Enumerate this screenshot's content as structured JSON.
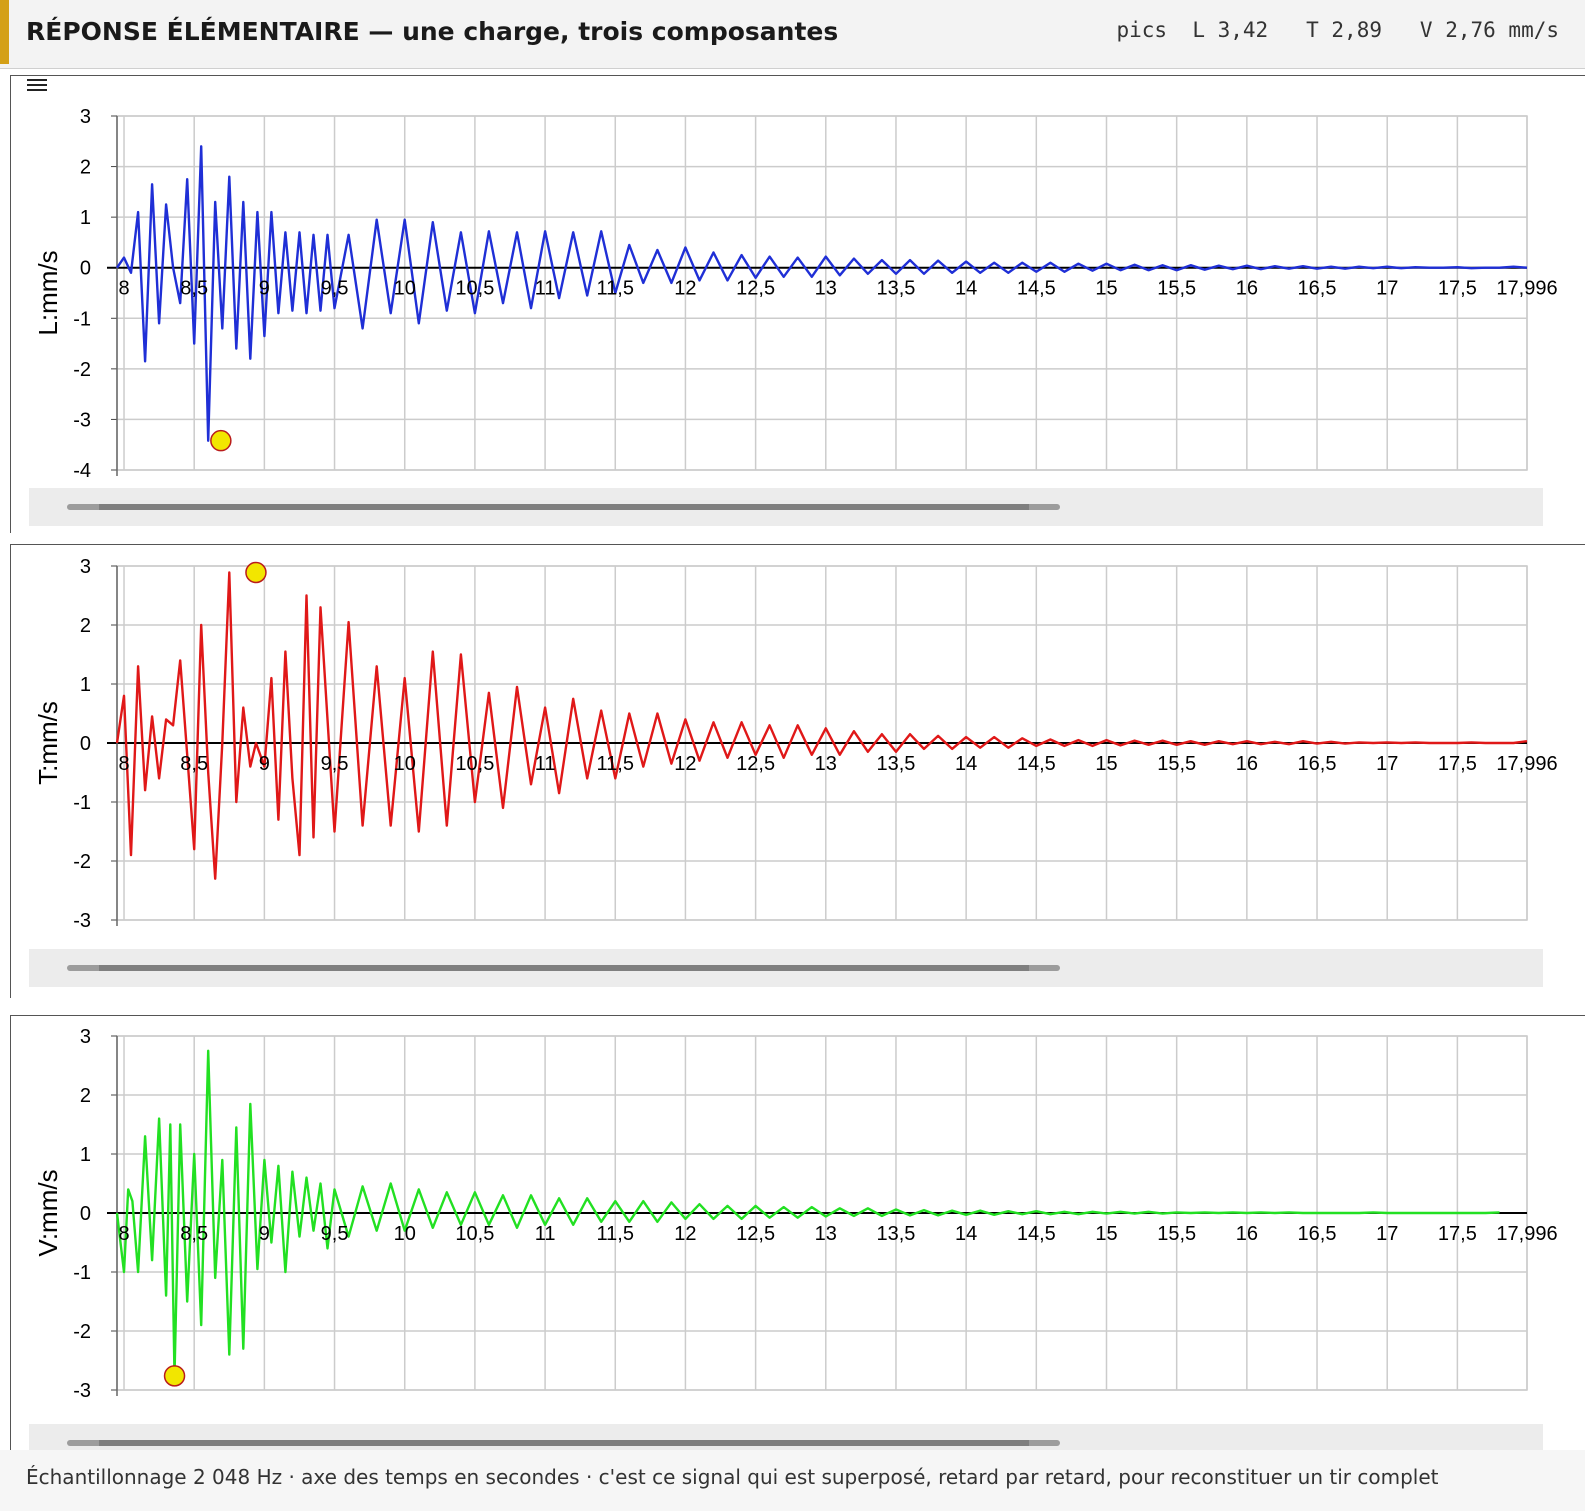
{
  "header": {
    "title": "RÉPONSE ÉLÉMENTAIRE — une charge, trois composantes",
    "peaks_text": "pics  L 3,42   T 2,89   V 2,76 mm/s"
  },
  "footer": {
    "caption": "Échantillonnage 2 048 Hz · axe des temps en secondes · c'est ce signal qui est superposé, retard par retard, pour reconstituer un tir complet"
  },
  "colors": {
    "accent": "#d4a017",
    "L": "#1f2fd6",
    "T": "#e01818",
    "V": "#22e022",
    "peak_marker": "#f2e600",
    "grid": "#cccccc"
  },
  "chart_data": [
    {
      "type": "line",
      "series": [
        {
          "values": "see x/y"
        }
      ],
      "ylabel": "L:mm/s",
      "xlim": [
        7.95,
        17.996
      ],
      "ylim": [
        -4,
        3
      ],
      "x_ticks": [
        "8",
        "8,5",
        "9",
        "9,5",
        "10",
        "10,5",
        "11",
        "11,5",
        "12",
        "12,5",
        "13",
        "13,5",
        "14",
        "14,5",
        "15",
        "15,5",
        "16",
        "16,5",
        "17",
        "17,5",
        "17,996"
      ],
      "x_tick_values": [
        8,
        8.5,
        9,
        9.5,
        10,
        10.5,
        11,
        11.5,
        12,
        12.5,
        13,
        13.5,
        14,
        14.5,
        15,
        15.5,
        16,
        16.5,
        17,
        17.5,
        17.996
      ],
      "y_ticks": [
        3,
        2,
        1,
        0,
        -1,
        -2,
        -3,
        -4
      ],
      "y_tick_labels": [
        "3",
        "2",
        "1",
        "0",
        "-1",
        "-2",
        "-3",
        "-4"
      ],
      "grid": true,
      "peak": {
        "x": 8.69,
        "y": -3.42
      },
      "x": [
        7.95,
        8.0,
        8.05,
        8.1,
        8.15,
        8.2,
        8.25,
        8.3,
        8.35,
        8.4,
        8.45,
        8.5,
        8.55,
        8.6,
        8.65,
        8.7,
        8.75,
        8.8,
        8.85,
        8.9,
        8.95,
        9.0,
        9.05,
        9.1,
        9.15,
        9.2,
        9.25,
        9.3,
        9.35,
        9.4,
        9.45,
        9.5,
        9.6,
        9.7,
        9.8,
        9.9,
        10.0,
        10.1,
        10.2,
        10.3,
        10.4,
        10.5,
        10.6,
        10.7,
        10.8,
        10.9,
        11.0,
        11.1,
        11.2,
        11.3,
        11.4,
        11.5,
        11.6,
        11.7,
        11.8,
        11.9,
        12.0,
        12.1,
        12.2,
        12.3,
        12.4,
        12.5,
        12.6,
        12.7,
        12.8,
        12.9,
        13.0,
        13.1,
        13.2,
        13.3,
        13.4,
        13.5,
        13.6,
        13.7,
        13.8,
        13.9,
        14.0,
        14.1,
        14.2,
        14.3,
        14.4,
        14.5,
        14.6,
        14.7,
        14.8,
        14.9,
        15.0,
        15.1,
        15.2,
        15.3,
        15.4,
        15.5,
        15.6,
        15.7,
        15.8,
        15.9,
        16.0,
        16.1,
        16.2,
        16.3,
        16.4,
        16.5,
        16.6,
        16.7,
        16.8,
        16.9,
        17.0,
        17.1,
        17.2,
        17.3,
        17.4,
        17.5,
        17.6,
        17.7,
        17.8,
        17.9,
        17.996
      ],
      "y": [
        0.0,
        0.2,
        -0.1,
        1.1,
        -1.85,
        1.65,
        -1.1,
        1.25,
        0.0,
        -0.7,
        1.75,
        -1.5,
        2.4,
        -3.42,
        1.3,
        -1.2,
        1.8,
        -1.6,
        1.3,
        -1.8,
        1.1,
        -1.35,
        1.1,
        -0.9,
        0.7,
        -0.85,
        0.7,
        -0.9,
        0.65,
        -0.85,
        0.65,
        -0.8,
        0.65,
        -1.2,
        0.95,
        -0.9,
        0.95,
        -1.1,
        0.9,
        -0.85,
        0.7,
        -0.9,
        0.72,
        -0.7,
        0.7,
        -0.8,
        0.72,
        -0.6,
        0.7,
        -0.55,
        0.72,
        -0.5,
        0.45,
        -0.3,
        0.35,
        -0.3,
        0.4,
        -0.25,
        0.3,
        -0.25,
        0.25,
        -0.2,
        0.22,
        -0.18,
        0.2,
        -0.18,
        0.22,
        -0.15,
        0.18,
        -0.12,
        0.15,
        -0.12,
        0.15,
        -0.12,
        0.14,
        -0.1,
        0.12,
        -0.1,
        0.1,
        -0.1,
        0.1,
        -0.08,
        0.1,
        -0.08,
        0.08,
        -0.06,
        0.08,
        -0.05,
        0.06,
        -0.05,
        0.05,
        -0.05,
        0.05,
        -0.04,
        0.04,
        -0.03,
        0.04,
        -0.03,
        0.03,
        -0.02,
        0.03,
        -0.02,
        0.02,
        -0.02,
        0.02,
        -0.01,
        0.02,
        -0.01,
        0.01,
        0.0,
        0.0,
        0.01,
        -0.01,
        0.0,
        0.0,
        0.02,
        0.0
      ]
    },
    {
      "type": "line",
      "series": [
        {
          "values": "see x/y"
        }
      ],
      "ylabel": "T:mm/s",
      "xlim": [
        7.95,
        17.996
      ],
      "ylim": [
        -3,
        3
      ],
      "x_ticks": [
        "8",
        "8,5",
        "9",
        "9,5",
        "10",
        "10,5",
        "11",
        "11,5",
        "12",
        "12,5",
        "13",
        "13,5",
        "14",
        "14,5",
        "15",
        "15,5",
        "16",
        "16,5",
        "17",
        "17,5",
        "17,996"
      ],
      "x_tick_values": [
        8,
        8.5,
        9,
        9.5,
        10,
        10.5,
        11,
        11.5,
        12,
        12.5,
        13,
        13.5,
        14,
        14.5,
        15,
        15.5,
        16,
        16.5,
        17,
        17.5,
        17.996
      ],
      "y_ticks": [
        3,
        2,
        1,
        0,
        -1,
        -2,
        -3
      ],
      "y_tick_labels": [
        "3",
        "2",
        "1",
        "0",
        "-1",
        "-2",
        "-3"
      ],
      "grid": true,
      "peak": {
        "x": 8.94,
        "y": 2.89
      },
      "x": [
        7.95,
        8.0,
        8.05,
        8.1,
        8.15,
        8.2,
        8.25,
        8.3,
        8.35,
        8.4,
        8.45,
        8.5,
        8.55,
        8.6,
        8.65,
        8.7,
        8.75,
        8.8,
        8.85,
        8.9,
        8.94,
        9.0,
        9.05,
        9.1,
        9.15,
        9.2,
        9.25,
        9.3,
        9.35,
        9.4,
        9.5,
        9.6,
        9.7,
        9.8,
        9.9,
        10.0,
        10.1,
        10.2,
        10.3,
        10.4,
        10.5,
        10.6,
        10.7,
        10.8,
        10.9,
        11.0,
        11.1,
        11.2,
        11.3,
        11.4,
        11.5,
        11.6,
        11.7,
        11.8,
        11.9,
        12.0,
        12.1,
        12.2,
        12.3,
        12.4,
        12.5,
        12.6,
        12.7,
        12.8,
        12.9,
        13.0,
        13.1,
        13.2,
        13.3,
        13.4,
        13.5,
        13.6,
        13.7,
        13.8,
        13.9,
        14.0,
        14.1,
        14.2,
        14.3,
        14.4,
        14.5,
        14.6,
        14.7,
        14.8,
        14.9,
        15.0,
        15.1,
        15.2,
        15.3,
        15.4,
        15.5,
        15.6,
        15.7,
        15.8,
        15.9,
        16.0,
        16.1,
        16.2,
        16.3,
        16.4,
        16.5,
        16.6,
        16.7,
        16.8,
        16.9,
        17.0,
        17.1,
        17.2,
        17.3,
        17.4,
        17.5,
        17.6,
        17.7,
        17.8,
        17.9,
        17.996
      ],
      "y": [
        0.0,
        0.8,
        -1.9,
        1.3,
        -0.8,
        0.45,
        -0.6,
        0.4,
        0.3,
        1.4,
        -0.2,
        -1.8,
        2.0,
        -0.5,
        -2.3,
        0.0,
        2.89,
        -1.0,
        0.6,
        -0.4,
        0.0,
        -0.4,
        1.1,
        -1.3,
        1.55,
        -0.6,
        -1.9,
        2.5,
        -1.6,
        2.3,
        -1.5,
        2.05,
        -1.4,
        1.3,
        -1.4,
        1.1,
        -1.5,
        1.55,
        -1.4,
        1.5,
        -1.0,
        0.85,
        -1.1,
        0.95,
        -0.7,
        0.6,
        -0.85,
        0.75,
        -0.6,
        0.55,
        -0.6,
        0.5,
        -0.4,
        0.5,
        -0.35,
        0.4,
        -0.3,
        0.35,
        -0.25,
        0.35,
        -0.2,
        0.3,
        -0.25,
        0.3,
        -0.2,
        0.25,
        -0.2,
        0.2,
        -0.15,
        0.15,
        -0.15,
        0.15,
        -0.1,
        0.12,
        -0.1,
        0.1,
        -0.08,
        0.1,
        -0.08,
        0.08,
        -0.05,
        0.06,
        -0.05,
        0.05,
        -0.05,
        0.05,
        -0.04,
        0.04,
        -0.03,
        0.04,
        -0.03,
        0.03,
        -0.03,
        0.03,
        -0.02,
        0.03,
        -0.02,
        0.02,
        -0.02,
        0.03,
        -0.01,
        0.02,
        -0.01,
        0.01,
        0.0,
        0.01,
        0.0,
        0.01,
        0.0,
        0.0,
        0.0,
        0.01,
        0.0,
        0.0,
        0.0,
        0.03
      ]
    },
    {
      "type": "line",
      "series": [
        {
          "values": "see x/y"
        }
      ],
      "ylabel": "V:mm/s",
      "xlim": [
        7.95,
        17.996
      ],
      "ylim": [
        -3,
        3
      ],
      "x_ticks": [
        "8",
        "8,5",
        "9",
        "9,5",
        "10",
        "10,5",
        "11",
        "11,5",
        "12",
        "12,5",
        "13",
        "13,5",
        "14",
        "14,5",
        "15",
        "15,5",
        "16",
        "16,5",
        "17",
        "17,5",
        "17,996"
      ],
      "x_tick_values": [
        8,
        8.5,
        9,
        9.5,
        10,
        10.5,
        11,
        11.5,
        12,
        12.5,
        13,
        13.5,
        14,
        14.5,
        15,
        15.5,
        16,
        16.5,
        17,
        17.5,
        17.996
      ],
      "y_ticks": [
        3,
        2,
        1,
        0,
        -1,
        -2,
        -3
      ],
      "y_tick_labels": [
        "3",
        "2",
        "1",
        "0",
        "-1",
        "-2",
        "-3"
      ],
      "grid": true,
      "peak": {
        "x": 8.36,
        "y": -2.76
      },
      "x": [
        7.95,
        8.0,
        8.03,
        8.06,
        8.1,
        8.15,
        8.2,
        8.25,
        8.3,
        8.33,
        8.36,
        8.4,
        8.45,
        8.5,
        8.55,
        8.6,
        8.65,
        8.7,
        8.75,
        8.8,
        8.85,
        8.9,
        8.95,
        9.0,
        9.05,
        9.1,
        9.15,
        9.2,
        9.25,
        9.3,
        9.35,
        9.4,
        9.45,
        9.5,
        9.6,
        9.7,
        9.8,
        9.9,
        10.0,
        10.1,
        10.2,
        10.3,
        10.4,
        10.5,
        10.6,
        10.7,
        10.8,
        10.9,
        11.0,
        11.1,
        11.2,
        11.3,
        11.4,
        11.5,
        11.6,
        11.7,
        11.8,
        11.9,
        12.0,
        12.1,
        12.2,
        12.3,
        12.4,
        12.5,
        12.6,
        12.7,
        12.8,
        12.9,
        13.0,
        13.1,
        13.2,
        13.3,
        13.4,
        13.5,
        13.6,
        13.7,
        13.8,
        13.9,
        14.0,
        14.1,
        14.2,
        14.3,
        14.4,
        14.5,
        14.6,
        14.7,
        14.8,
        14.9,
        15.0,
        15.1,
        15.2,
        15.3,
        15.4,
        15.5,
        15.6,
        15.7,
        15.8,
        15.9,
        16.0,
        16.1,
        16.2,
        16.3,
        16.4,
        16.5,
        16.6,
        16.7,
        16.8,
        16.9,
        17.0,
        17.1,
        17.2,
        17.3,
        17.4,
        17.5,
        17.6,
        17.7,
        17.8,
        17.9,
        17.996
      ],
      "y": [
        0.0,
        -1.0,
        0.4,
        0.2,
        -1.0,
        1.3,
        -0.8,
        1.6,
        -1.4,
        1.5,
        -2.76,
        1.5,
        -1.5,
        1.0,
        -1.9,
        2.75,
        -1.1,
        0.9,
        -2.4,
        1.45,
        -2.3,
        1.85,
        -0.95,
        0.9,
        -0.5,
        0.8,
        -1.0,
        0.7,
        -0.4,
        0.6,
        -0.3,
        0.5,
        -0.6,
        0.4,
        -0.4,
        0.45,
        -0.3,
        0.5,
        -0.3,
        0.4,
        -0.25,
        0.35,
        -0.2,
        0.35,
        -0.2,
        0.3,
        -0.25,
        0.3,
        -0.2,
        0.25,
        -0.2,
        0.25,
        -0.15,
        0.2,
        -0.15,
        0.2,
        -0.15,
        0.18,
        -0.1,
        0.15,
        -0.1,
        0.12,
        -0.1,
        0.12,
        -0.08,
        0.1,
        -0.08,
        0.1,
        -0.06,
        0.08,
        -0.05,
        0.08,
        -0.05,
        0.06,
        -0.04,
        0.05,
        -0.04,
        0.04,
        -0.03,
        0.04,
        -0.03,
        0.03,
        -0.02,
        0.03,
        -0.02,
        0.02,
        -0.02,
        0.02,
        -0.01,
        0.02,
        -0.01,
        0.02,
        -0.01,
        0.01,
        0.0,
        0.01,
        0.0,
        0.01,
        0.0,
        0.01,
        0.0,
        0.01,
        0.0,
        0.0,
        0.0,
        0.0,
        0.0,
        0.01,
        0.0,
        0.0,
        0.0,
        0.0,
        0.0,
        0.0,
        0.0,
        0.0,
        0.01
      ]
    }
  ]
}
